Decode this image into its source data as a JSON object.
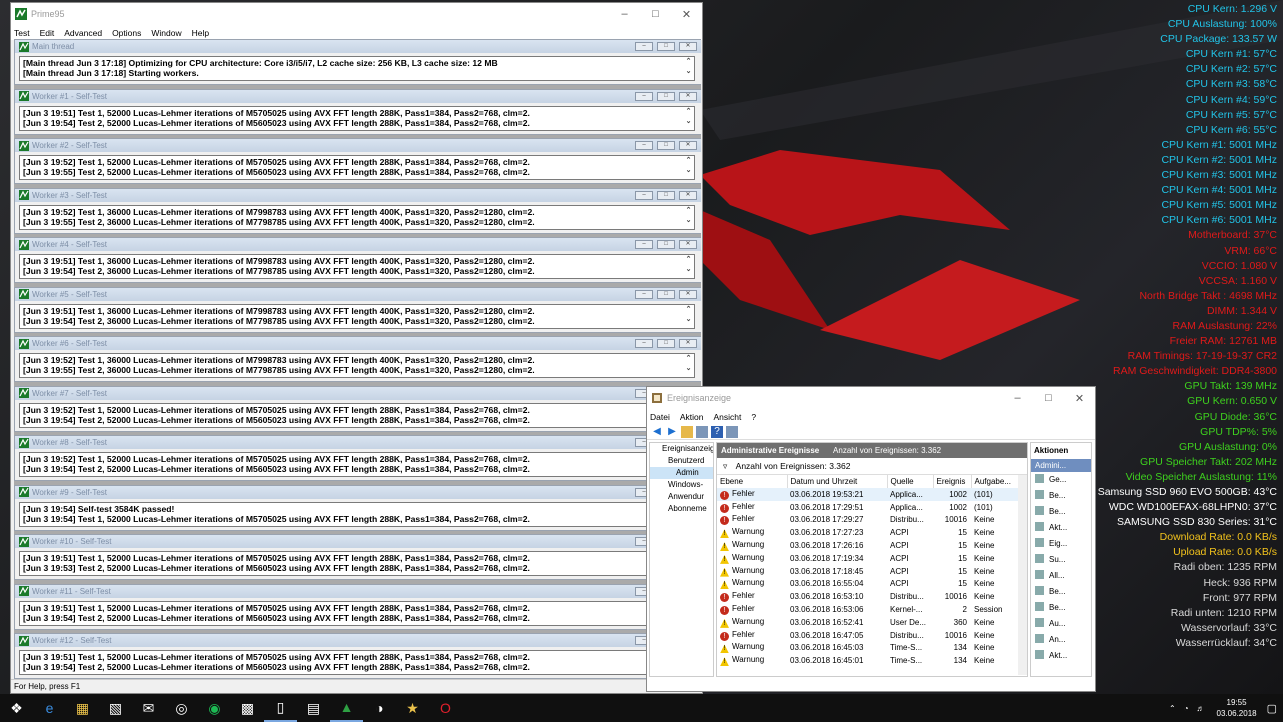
{
  "prime95": {
    "title": "Prime95",
    "menu": [
      "Test",
      "Edit",
      "Advanced",
      "Options",
      "Window",
      "Help"
    ],
    "status": "For Help, press F1",
    "children": [
      {
        "title": "Main thread",
        "lines": [
          "[Main thread Jun 3 17:18] Optimizing for CPU architecture: Core i3/i5/i7, L2 cache size: 256 KB, L3 cache size: 12 MB",
          "[Main thread Jun 3 17:18] Starting workers."
        ]
      },
      {
        "title": "Worker #1 - Self-Test",
        "lines": [
          "[Jun 3 19:51] Test 1, 52000 Lucas-Lehmer iterations of M5705025 using AVX FFT length 288K, Pass1=384, Pass2=768, clm=2.",
          "[Jun 3 19:54] Test 2, 52000 Lucas-Lehmer iterations of M5605023 using AVX FFT length 288K, Pass1=384, Pass2=768, clm=2."
        ]
      },
      {
        "title": "Worker #2 - Self-Test",
        "lines": [
          "[Jun 3 19:52] Test 1, 52000 Lucas-Lehmer iterations of M5705025 using AVX FFT length 288K, Pass1=384, Pass2=768, clm=2.",
          "[Jun 3 19:55] Test 2, 52000 Lucas-Lehmer iterations of M5605023 using AVX FFT length 288K, Pass1=384, Pass2=768, clm=2."
        ]
      },
      {
        "title": "Worker #3 - Self-Test",
        "lines": [
          "[Jun 3 19:52] Test 1, 36000 Lucas-Lehmer iterations of M7998783 using AVX FFT length 400K, Pass1=320, Pass2=1280, clm=2.",
          "[Jun 3 19:55] Test 2, 36000 Lucas-Lehmer iterations of M7798785 using AVX FFT length 400K, Pass1=320, Pass2=1280, clm=2."
        ]
      },
      {
        "title": "Worker #4 - Self-Test",
        "lines": [
          "[Jun 3 19:51] Test 1, 36000 Lucas-Lehmer iterations of M7998783 using AVX FFT length 400K, Pass1=320, Pass2=1280, clm=2.",
          "[Jun 3 19:54] Test 2, 36000 Lucas-Lehmer iterations of M7798785 using AVX FFT length 400K, Pass1=320, Pass2=1280, clm=2."
        ]
      },
      {
        "title": "Worker #5 - Self-Test",
        "lines": [
          "[Jun 3 19:51] Test 1, 36000 Lucas-Lehmer iterations of M7998783 using AVX FFT length 400K, Pass1=320, Pass2=1280, clm=2.",
          "[Jun 3 19:54] Test 2, 36000 Lucas-Lehmer iterations of M7798785 using AVX FFT length 400K, Pass1=320, Pass2=1280, clm=2."
        ]
      },
      {
        "title": "Worker #6 - Self-Test",
        "lines": [
          "[Jun 3 19:52] Test 1, 36000 Lucas-Lehmer iterations of M7998783 using AVX FFT length 400K, Pass1=320, Pass2=1280, clm=2.",
          "[Jun 3 19:55] Test 2, 36000 Lucas-Lehmer iterations of M7798785 using AVX FFT length 400K, Pass1=320, Pass2=1280, clm=2."
        ]
      },
      {
        "title": "Worker #7 - Self-Test",
        "lines": [
          "[Jun 3 19:52] Test 1, 52000 Lucas-Lehmer iterations of M5705025 using AVX FFT length 288K, Pass1=384, Pass2=768, clm=2.",
          "[Jun 3 19:54] Test 2, 52000 Lucas-Lehmer iterations of M5605023 using AVX FFT length 288K, Pass1=384, Pass2=768, clm=2."
        ]
      },
      {
        "title": "Worker #8 - Self-Test",
        "lines": [
          "[Jun 3 19:52] Test 1, 52000 Lucas-Lehmer iterations of M5705025 using AVX FFT length 288K, Pass1=384, Pass2=768, clm=2.",
          "[Jun 3 19:54] Test 2, 52000 Lucas-Lehmer iterations of M5605023 using AVX FFT length 288K, Pass1=384, Pass2=768, clm=2."
        ]
      },
      {
        "title": "Worker #9 - Self-Test",
        "lines": [
          "[Jun 3 19:54] Self-test 3584K passed!",
          "[Jun 3 19:54] Test 1, 52000 Lucas-Lehmer iterations of M5705025 using AVX FFT length 288K, Pass1=384, Pass2=768, clm=2."
        ]
      },
      {
        "title": "Worker #10 - Self-Test",
        "lines": [
          "[Jun 3 19:51] Test 1, 52000 Lucas-Lehmer iterations of M5705025 using AVX FFT length 288K, Pass1=384, Pass2=768, clm=2.",
          "[Jun 3 19:53] Test 2, 52000 Lucas-Lehmer iterations of M5605023 using AVX FFT length 288K, Pass1=384, Pass2=768, clm=2."
        ]
      },
      {
        "title": "Worker #11 - Self-Test",
        "lines": [
          "[Jun 3 19:51] Test 1, 52000 Lucas-Lehmer iterations of M5705025 using AVX FFT length 288K, Pass1=384, Pass2=768, clm=2.",
          "[Jun 3 19:54] Test 2, 52000 Lucas-Lehmer iterations of M5605023 using AVX FFT length 288K, Pass1=384, Pass2=768, clm=2."
        ]
      },
      {
        "title": "Worker #12 - Self-Test",
        "lines": [
          "[Jun 3 19:51] Test 1, 52000 Lucas-Lehmer iterations of M5705025 using AVX FFT length 288K, Pass1=384, Pass2=768, clm=2.",
          "[Jun 3 19:54] Test 2, 52000 Lucas-Lehmer iterations of M5605023 using AVX FFT length 288K, Pass1=384, Pass2=768, clm=2."
        ]
      }
    ]
  },
  "eventviewer": {
    "title": "Ereignisanzeige",
    "menu": [
      "Datei",
      "Aktion",
      "Ansicht",
      "?"
    ],
    "tree": [
      "Ereignisanzeig",
      "Benutzerd",
      "Admin",
      "Windows-",
      "Anwendur",
      "Abonneme"
    ],
    "header_title": "Administrative Ereignisse",
    "header_count": "Anzahl von Ereignissen: 3.362",
    "filter_text": "Anzahl von Ereignissen: 3.362",
    "columns": [
      "Ebene",
      "Datum und Uhrzeit",
      "Quelle",
      "Ereignis",
      "Aufgabe..."
    ],
    "rows": [
      {
        "level": "Fehler",
        "kind": "err",
        "date": "03.06.2018 19:53:21",
        "source": "Applica...",
        "id": "1002",
        "task": "(101)"
      },
      {
        "level": "Fehler",
        "kind": "err",
        "date": "03.06.2018 17:29:51",
        "source": "Applica...",
        "id": "1002",
        "task": "(101)"
      },
      {
        "level": "Fehler",
        "kind": "err",
        "date": "03.06.2018 17:29:27",
        "source": "Distribu...",
        "id": "10016",
        "task": "Keine"
      },
      {
        "level": "Warnung",
        "kind": "warn",
        "date": "03.06.2018 17:27:23",
        "source": "ACPI",
        "id": "15",
        "task": "Keine"
      },
      {
        "level": "Warnung",
        "kind": "warn",
        "date": "03.06.2018 17:26:16",
        "source": "ACPI",
        "id": "15",
        "task": "Keine"
      },
      {
        "level": "Warnung",
        "kind": "warn",
        "date": "03.06.2018 17:19:34",
        "source": "ACPI",
        "id": "15",
        "task": "Keine"
      },
      {
        "level": "Warnung",
        "kind": "warn",
        "date": "03.06.2018 17:18:45",
        "source": "ACPI",
        "id": "15",
        "task": "Keine"
      },
      {
        "level": "Warnung",
        "kind": "warn",
        "date": "03.06.2018 16:55:04",
        "source": "ACPI",
        "id": "15",
        "task": "Keine"
      },
      {
        "level": "Fehler",
        "kind": "err",
        "date": "03.06.2018 16:53:10",
        "source": "Distribu...",
        "id": "10016",
        "task": "Keine"
      },
      {
        "level": "Fehler",
        "kind": "err",
        "date": "03.06.2018 16:53:06",
        "source": "Kernel-...",
        "id": "2",
        "task": "Session"
      },
      {
        "level": "Warnung",
        "kind": "warn",
        "date": "03.06.2018 16:52:41",
        "source": "User De...",
        "id": "360",
        "task": "Keine"
      },
      {
        "level": "Fehler",
        "kind": "err",
        "date": "03.06.2018 16:47:05",
        "source": "Distribu...",
        "id": "10016",
        "task": "Keine"
      },
      {
        "level": "Warnung",
        "kind": "warn",
        "date": "03.06.2018 16:45:03",
        "source": "Time-S...",
        "id": "134",
        "task": "Keine"
      },
      {
        "level": "Warnung",
        "kind": "warn",
        "date": "03.06.2018 16:45:01",
        "source": "Time-S...",
        "id": "134",
        "task": "Keine"
      }
    ],
    "actions_title": "Aktionen",
    "actions_sub": "Admini...",
    "actions": [
      "Ge...",
      "Be...",
      "Be...",
      "Akt...",
      "Eig...",
      "Su...",
      "All...",
      "Be...",
      "Be...",
      "Au...",
      "An...",
      "Akt..."
    ]
  },
  "osd": [
    {
      "text": "CPU Kern: 1.296 V",
      "color": "#22c4e8"
    },
    {
      "text": "CPU Auslastung: 100%",
      "color": "#22c4e8"
    },
    {
      "text": "CPU Package: 133.57 W",
      "color": "#22c4e8"
    },
    {
      "text": "CPU Kern #1: 57°C",
      "color": "#22c4e8"
    },
    {
      "text": "CPU Kern #2: 57°C",
      "color": "#22c4e8"
    },
    {
      "text": "CPU Kern #3: 58°C",
      "color": "#22c4e8"
    },
    {
      "text": "CPU Kern #4: 59°C",
      "color": "#22c4e8"
    },
    {
      "text": "CPU Kern #5: 57°C",
      "color": "#22c4e8"
    },
    {
      "text": "CPU Kern #6: 55°C",
      "color": "#22c4e8"
    },
    {
      "text": "CPU Kern #1: 5001 MHz",
      "color": "#22c4e8"
    },
    {
      "text": "CPU Kern #2: 5001 MHz",
      "color": "#22c4e8"
    },
    {
      "text": "CPU Kern #3: 5001 MHz",
      "color": "#22c4e8"
    },
    {
      "text": "CPU Kern #4: 5001 MHz",
      "color": "#22c4e8"
    },
    {
      "text": "CPU Kern #5: 5001 MHz",
      "color": "#22c4e8"
    },
    {
      "text": "CPU Kern #6: 5001 MHz",
      "color": "#22c4e8"
    },
    {
      "text": "Motherboard: 37°C",
      "color": "#e01a1a"
    },
    {
      "text": "VRM: 66°C",
      "color": "#e01a1a"
    },
    {
      "text": "VCCIO: 1.080 V",
      "color": "#e01a1a"
    },
    {
      "text": "VCCSA: 1.160 V",
      "color": "#e01a1a"
    },
    {
      "text": "North Bridge Takt : 4698 MHz",
      "color": "#e01a1a"
    },
    {
      "text": "DIMM: 1.344 V",
      "color": "#e01a1a"
    },
    {
      "text": "RAM Auslastung: 22%",
      "color": "#e01a1a"
    },
    {
      "text": "Freier RAM: 12761 MB",
      "color": "#e01a1a"
    },
    {
      "text": "RAM Timings: 17-19-19-37 CR2",
      "color": "#e01a1a"
    },
    {
      "text": "RAM Geschwindigkeit: DDR4-3800",
      "color": "#e01a1a"
    },
    {
      "text": "GPU Takt: 139 MHz",
      "color": "#3ed11e"
    },
    {
      "text": "GPU Kern: 0.650 V",
      "color": "#3ed11e"
    },
    {
      "text": "GPU Diode: 36°C",
      "color": "#3ed11e"
    },
    {
      "text": "GPU TDP%: 5%",
      "color": "#3ed11e"
    },
    {
      "text": "GPU Auslastung: 0%",
      "color": "#3ed11e"
    },
    {
      "text": "GPU Speicher Takt: 202 MHz",
      "color": "#3ed11e"
    },
    {
      "text": "Video Speicher Auslastung: 11%",
      "color": "#3ed11e"
    },
    {
      "text": "Samsung SSD 960 EVO 500GB: 43°C",
      "color": "#ffffff"
    },
    {
      "text": "WDC WD100EFAX-68LHPN0: 37°C",
      "color": "#ffffff"
    },
    {
      "text": "SAMSUNG SSD 830 Series: 31°C",
      "color": "#ffffff"
    },
    {
      "text": "Download Rate: 0.0 KB/s",
      "color": "#f2c21c"
    },
    {
      "text": "Upload Rate: 0.0 KB/s",
      "color": "#f2c21c"
    },
    {
      "text": "Radi oben: 1235 RPM",
      "color": "#d9d9d9"
    },
    {
      "text": "Heck: 936 RPM",
      "color": "#d9d9d9"
    },
    {
      "text": "Front: 977 RPM",
      "color": "#d9d9d9"
    },
    {
      "text": "Radi unten: 1210 RPM",
      "color": "#d9d9d9"
    },
    {
      "text": "Wasservorlauf: 33°C",
      "color": "#d9d9d9"
    },
    {
      "text": "Wasserrücklauf: 34°C",
      "color": "#d9d9d9"
    }
  ],
  "taskbar": {
    "icons": [
      "windows-start-icon",
      "edge-icon",
      "explorer-icon",
      "store-icon",
      "mail-icon",
      "media-icon",
      "spotify-icon",
      "app-grid-icon",
      "device-icon",
      "notepad-icon",
      "prime95-icon",
      "app-icon",
      "yellow-app-icon",
      "opera-icon"
    ],
    "time": "19:55",
    "date": "03.06.2018"
  }
}
